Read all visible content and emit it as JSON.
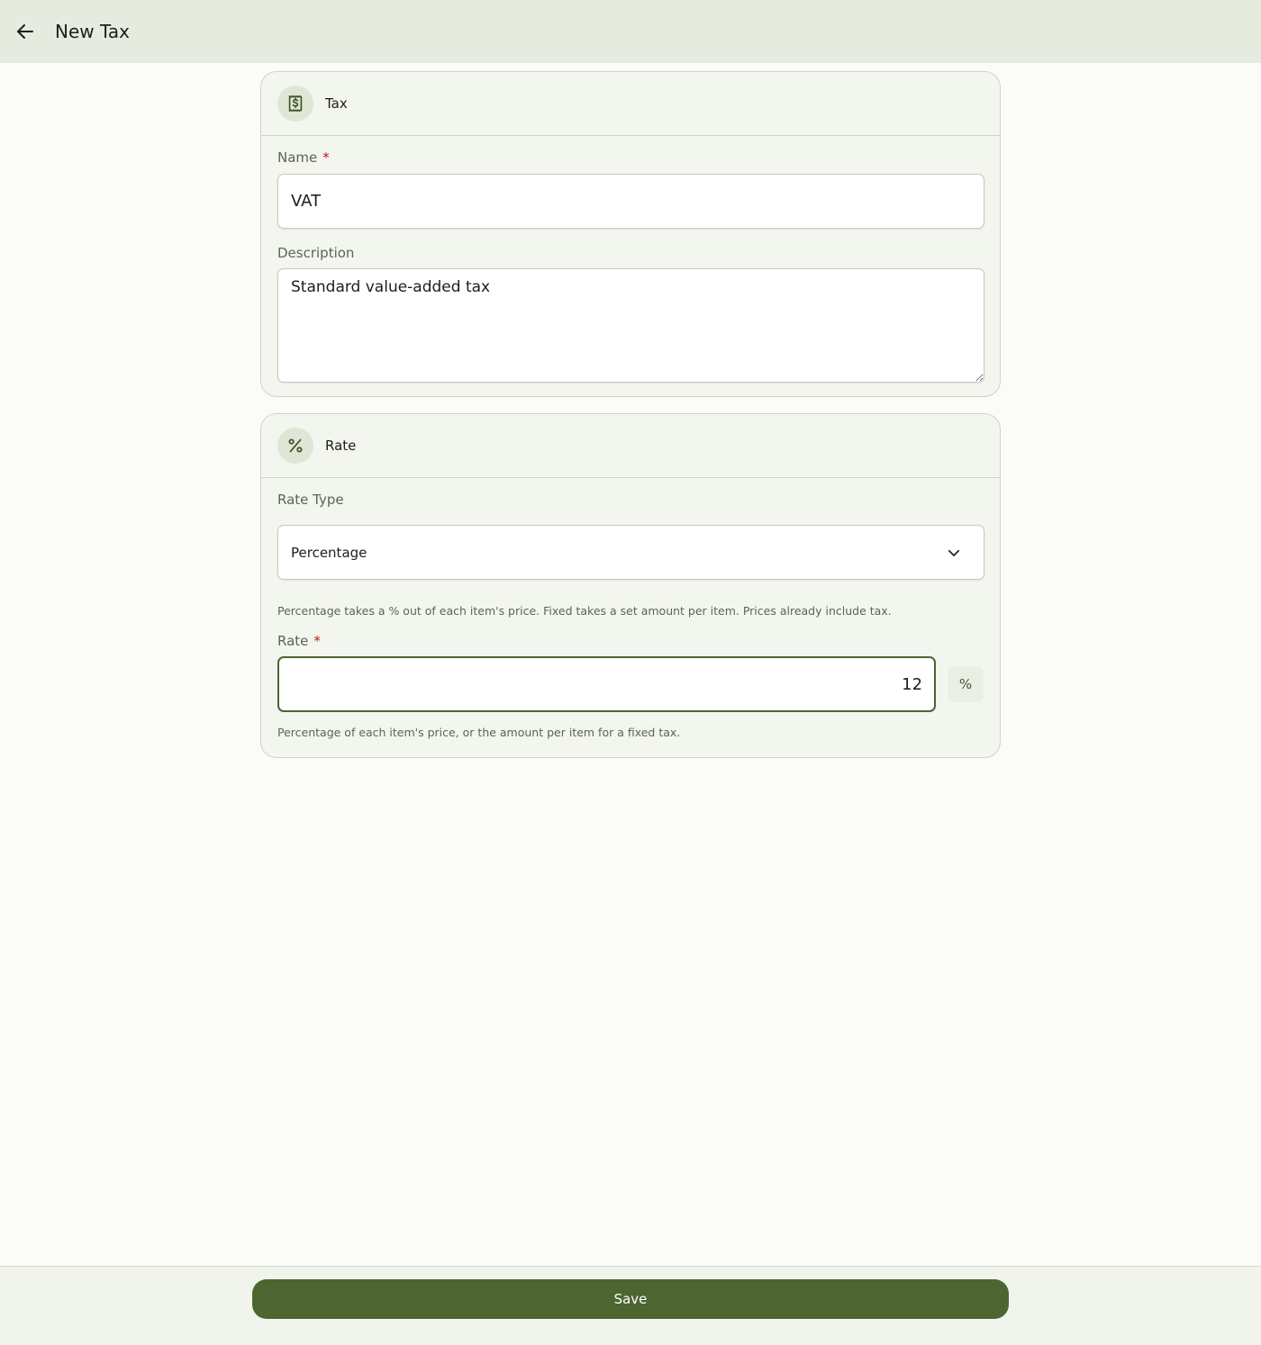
{
  "topbar": {
    "title": "New Tax",
    "back_icon": "arrow-left-icon"
  },
  "tax_card": {
    "icon": "receipt-dollar-icon",
    "title": "Tax",
    "name_label": "Name",
    "name_required": "*",
    "name_value": "VAT",
    "description_label": "Description",
    "description_value": "Standard value-added tax"
  },
  "rate_card": {
    "icon": "percent-icon",
    "title": "Rate",
    "rate_type_label": "Rate Type",
    "rate_type_value": "Percentage",
    "rate_type_helper": "Percentage takes a % out of each item's price. Fixed takes a set amount per item. Prices already include tax.",
    "rate_label": "Rate",
    "rate_required": "*",
    "rate_value": "12",
    "rate_unit": "%",
    "rate_helper": "Percentage of each item's price, or the amount per item for a fixed tax."
  },
  "footer": {
    "save_label": "Save"
  },
  "colors": {
    "primary": "#4d6530",
    "topbar_bg": "#e5ebdf",
    "card_bg": "#f3f6ee",
    "required": "#ba1a1a"
  }
}
